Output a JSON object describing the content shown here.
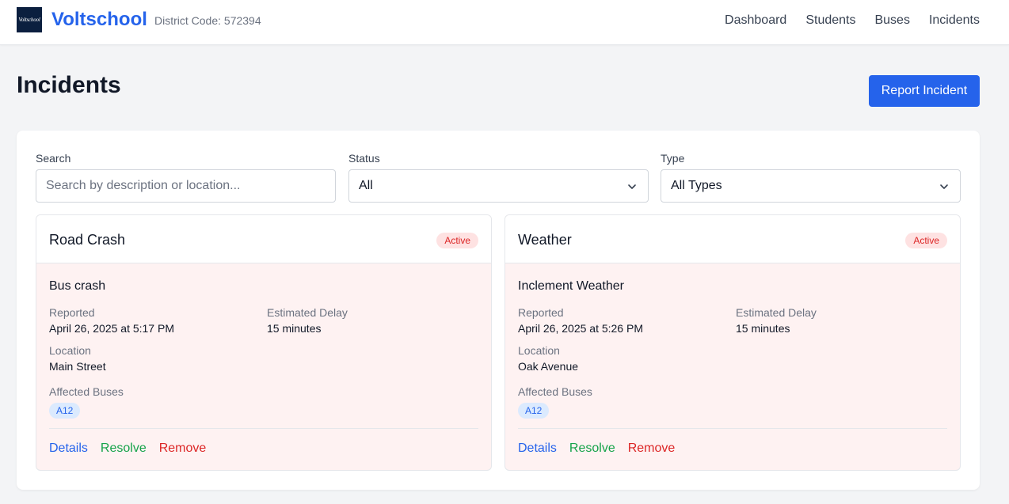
{
  "header": {
    "logo_text": "Voltschool",
    "brand": "Voltschool",
    "district": "District Code: 572394",
    "nav": [
      "Dashboard",
      "Students",
      "Buses",
      "Incidents"
    ]
  },
  "page": {
    "title": "Incidents",
    "report_button": "Report Incident"
  },
  "filters": {
    "search_label": "Search",
    "search_placeholder": "Search by description or location...",
    "search_value": "",
    "status_label": "Status",
    "status_value": "All",
    "type_label": "Type",
    "type_value": "All Types"
  },
  "labels": {
    "reported": "Reported",
    "estimated_delay": "Estimated Delay",
    "location": "Location",
    "affected_buses": "Affected Buses"
  },
  "incidents": [
    {
      "type": "Road Crash",
      "status": "Active",
      "description": "Bus crash",
      "reported": "April 26, 2025 at 5:17 PM",
      "delay": "15 minutes",
      "location": "Main Street",
      "buses": [
        "A12"
      ],
      "actions": {
        "details": "Details",
        "resolve": "Resolve",
        "remove": "Remove"
      }
    },
    {
      "type": "Weather",
      "status": "Active",
      "description": "Inclement Weather",
      "reported": "April 26, 2025 at 5:26 PM",
      "delay": "15 minutes",
      "location": "Oak Avenue",
      "buses": [
        "A12"
      ],
      "actions": {
        "details": "Details",
        "resolve": "Resolve",
        "remove": "Remove"
      }
    }
  ],
  "colors": {
    "primary": "#2563eb",
    "danger": "#dc2626",
    "success": "#16a34a",
    "card_bg": "#fef2f2"
  }
}
